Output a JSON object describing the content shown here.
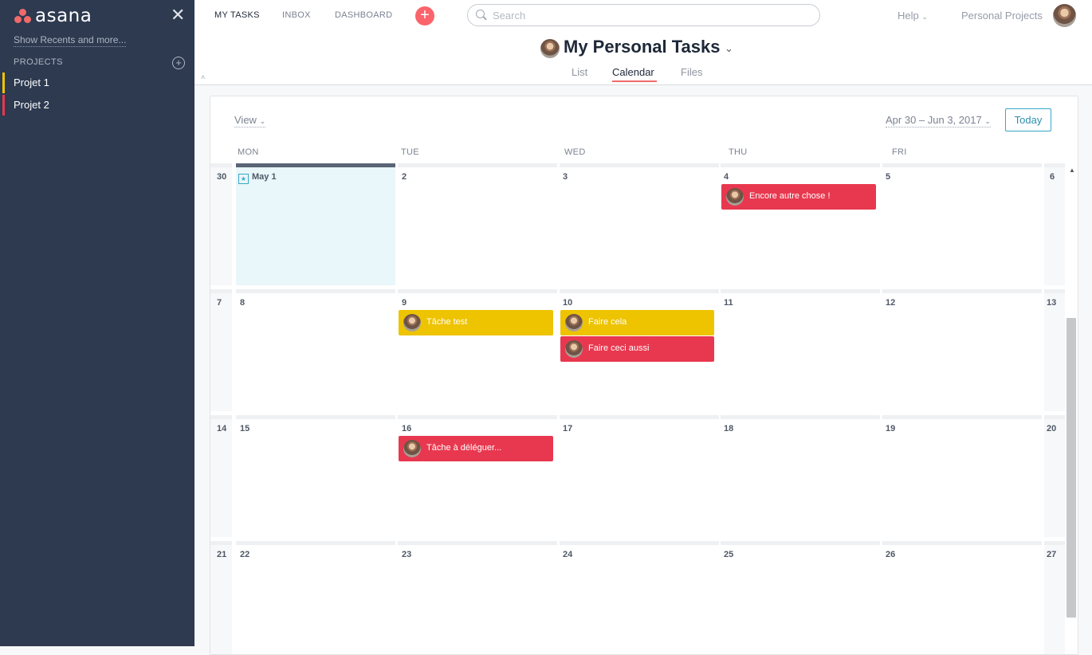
{
  "sidebar": {
    "logo_text": "asana",
    "show_recents": "Show Recents and more...",
    "projects_title": "PROJECTS",
    "projects": [
      {
        "label": "Projet 1",
        "color": "#eec300"
      },
      {
        "label": "Projet 2",
        "color": "#e8384f"
      }
    ]
  },
  "topbar": {
    "nav": [
      "MY TASKS",
      "INBOX",
      "DASHBOARD"
    ],
    "search_placeholder": "Search",
    "help": "Help",
    "personal_projects": "Personal Projects"
  },
  "header": {
    "title": "My Personal Tasks",
    "tabs": [
      "List",
      "Calendar",
      "Files"
    ],
    "active_tab": "Calendar"
  },
  "calendar": {
    "view_label": "View",
    "range_label": "Apr 30 – Jun 3, 2017",
    "today_label": "Today",
    "weekdays": [
      "MON",
      "TUE",
      "WED",
      "THU",
      "FRI"
    ],
    "weeks": [
      [
        "30",
        "May 1",
        "2",
        "3",
        "4",
        "5",
        "6"
      ],
      [
        "7",
        "8",
        "9",
        "10",
        "11",
        "12",
        "13"
      ],
      [
        "14",
        "15",
        "16",
        "17",
        "18",
        "19",
        "20"
      ],
      [
        "21",
        "22",
        "23",
        "24",
        "25",
        "26",
        "27"
      ]
    ],
    "tasks": [
      {
        "label": "Encore autre chose !",
        "color": "red"
      },
      {
        "label": "Tâche test",
        "color": "yellow"
      },
      {
        "label": "Faire cela",
        "color": "yellow"
      },
      {
        "label": "Faire ceci aussi",
        "color": "red"
      },
      {
        "label": "Tâche à déléguer...",
        "color": "red"
      }
    ]
  },
  "colors": {
    "sidebar_bg": "#2d3a50",
    "accent": "#f06a6a",
    "task_red": "#e8384f",
    "task_yellow": "#eec300",
    "today_button": "#37a8c7"
  }
}
